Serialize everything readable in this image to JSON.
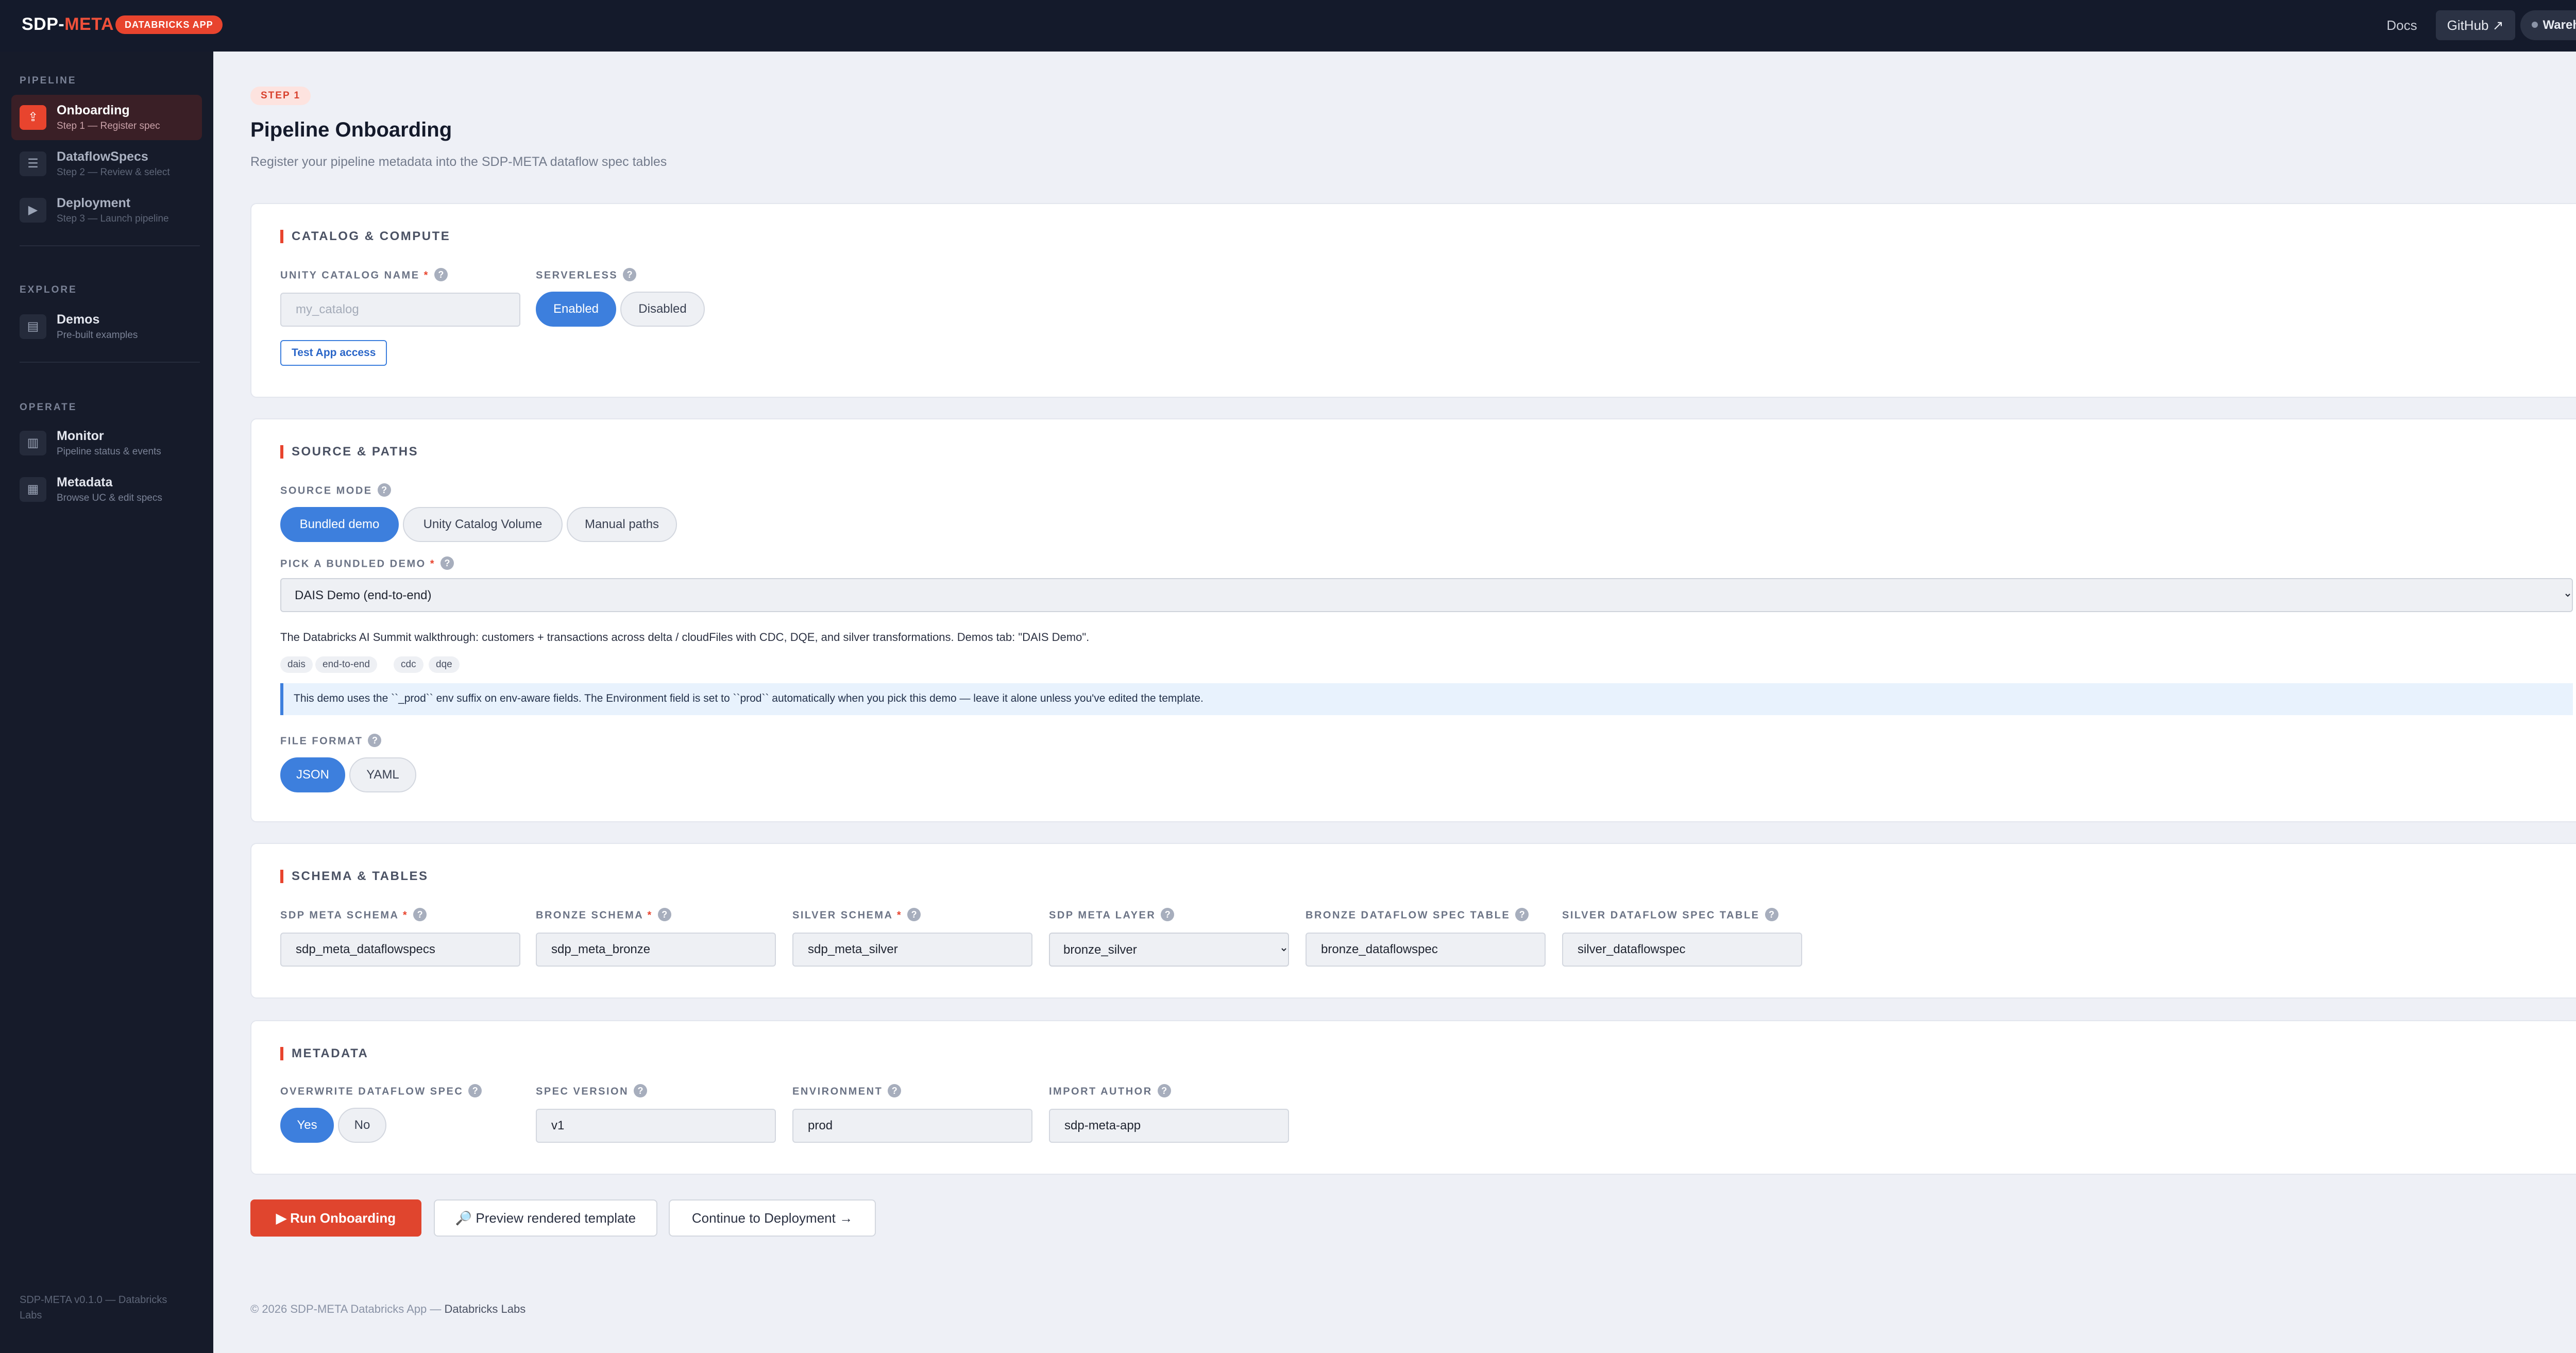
{
  "header": {
    "brand_part1": "SDP-",
    "brand_part2": "META",
    "badge": "DATABRICKS APP",
    "docs": "Docs",
    "github": "GitHub ↗",
    "warehouse": "Warehouse"
  },
  "sidebar": {
    "sections": {
      "pipeline": "PIPELINE",
      "explore": "EXPLORE",
      "operate": "OPERATE"
    },
    "items": [
      {
        "title": "Onboarding",
        "sub": "Step 1 — Register spec",
        "icon": "⇪"
      },
      {
        "title": "DataflowSpecs",
        "sub": "Step 2 — Review & select",
        "icon": "☰"
      },
      {
        "title": "Deployment",
        "sub": "Step 3 — Launch pipeline",
        "icon": "▶"
      },
      {
        "title": "Demos",
        "sub": "Pre-built examples",
        "icon": "▤"
      },
      {
        "title": "Monitor",
        "sub": "Pipeline status & events",
        "icon": "▥"
      },
      {
        "title": "Metadata",
        "sub": "Browse UC & edit specs",
        "icon": "▦"
      }
    ],
    "footer": "SDP-META v0.1.0 — Databricks Labs"
  },
  "page": {
    "step": "STEP 1",
    "title": "Pipeline Onboarding",
    "subtitle": "Register your pipeline metadata into the SDP-META dataflow spec tables"
  },
  "catalog": {
    "title": "CATALOG & COMPUTE",
    "uc_label": "UNITY CATALOG NAME",
    "uc_placeholder": "my_catalog",
    "uc_value": "",
    "serverless_label": "SERVERLESS",
    "enabled": "Enabled",
    "disabled": "Disabled",
    "test_btn": "Test App access"
  },
  "source": {
    "title": "SOURCE & PATHS",
    "mode_label": "SOURCE MODE",
    "modes": [
      "Bundled demo",
      "Unity Catalog Volume",
      "Manual paths"
    ],
    "demo_label": "PICK A BUNDLED DEMO",
    "demo_selected": "DAIS Demo (end-to-end)",
    "description": "The Databricks AI Summit walkthrough: customers + transactions across delta / cloudFiles with CDC, DQE, and silver transformations. Demos tab: \"DAIS Demo\".",
    "tags": [
      "dais",
      "end-to-end",
      "cdc",
      "dqe"
    ],
    "info": "This demo uses the ``_prod`` env suffix on env-aware fields. The Environment field is set to ``prod`` automatically when you pick this demo — leave it alone unless you've edited the template.",
    "format_label": "FILE FORMAT",
    "formats": [
      "JSON",
      "YAML"
    ]
  },
  "schema": {
    "title": "SCHEMA & TABLES",
    "fields": [
      {
        "label": "SDP META SCHEMA",
        "value": "sdp_meta_dataflowspecs"
      },
      {
        "label": "BRONZE SCHEMA",
        "value": "sdp_meta_bronze"
      },
      {
        "label": "SILVER SCHEMA",
        "value": "sdp_meta_silver"
      },
      {
        "label": "SDP META LAYER",
        "value": "bronze_silver"
      },
      {
        "label": "BRONZE DATAFLOW SPEC TABLE",
        "value": "bronze_dataflowspec"
      },
      {
        "label": "SILVER DATAFLOW SPEC TABLE",
        "value": "silver_dataflowspec"
      }
    ]
  },
  "metadata": {
    "title": "METADATA",
    "overwrite_label": "OVERWRITE DATAFLOW SPEC",
    "yes": "Yes",
    "no": "No",
    "spec_version_label": "SPEC VERSION",
    "spec_version": "v1",
    "environment_label": "ENVIRONMENT",
    "environment": "prod",
    "import_author_label": "IMPORT AUTHOR",
    "import_author": "sdp-meta-app"
  },
  "actions": {
    "run": "▶ Run Onboarding",
    "preview": "🔎 Preview rendered template",
    "continue": "Continue to Deployment →"
  },
  "footer": {
    "text": "© 2026 SDP-META Databricks App — ",
    "strong": "Databricks Labs"
  },
  "colors": {
    "accent": "#e8442e",
    "primary_blue": "#3d7fdd",
    "topbar": "#141a2b",
    "sidebar": "#161b2a"
  }
}
